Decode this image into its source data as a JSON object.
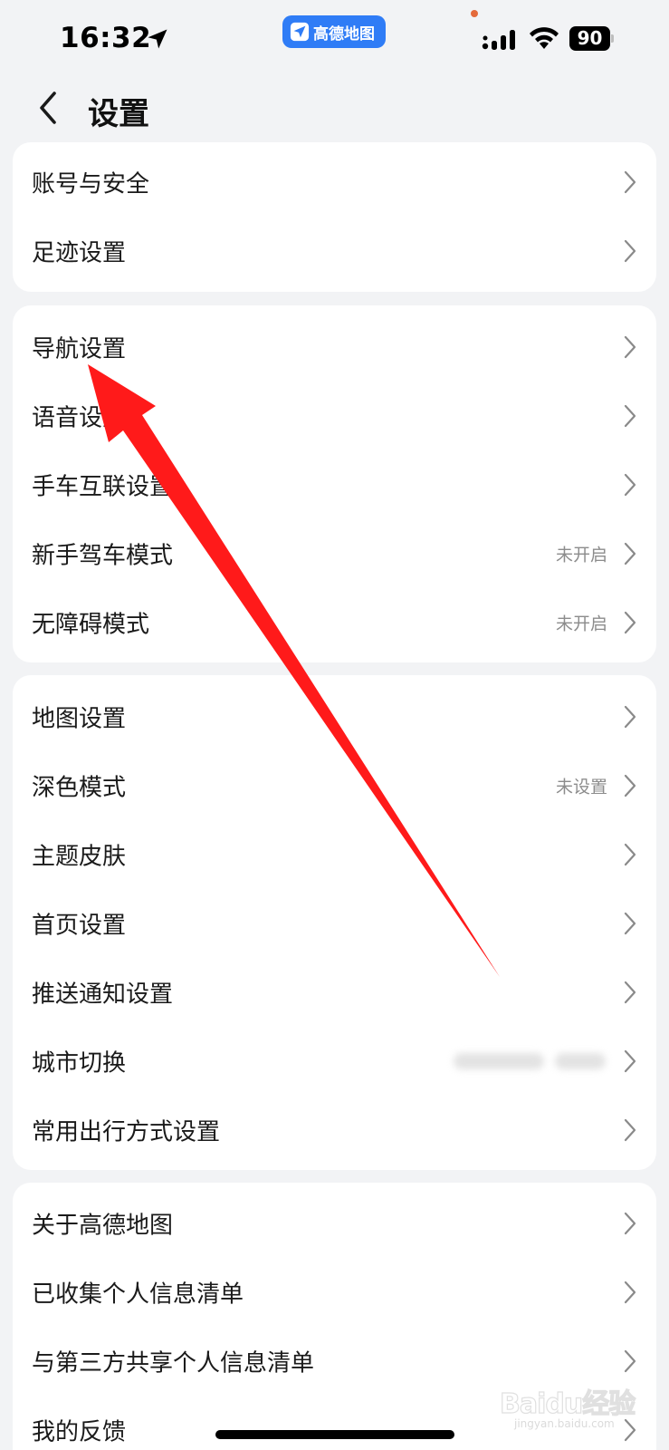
{
  "status_bar": {
    "time": "16:32",
    "app_pill_label": "高德地图",
    "battery": "90",
    "icons": [
      "location-arrow-icon",
      "signal-icon",
      "wifi-icon",
      "battery-icon"
    ]
  },
  "header": {
    "title": "设置"
  },
  "groups": [
    {
      "items": [
        {
          "label": "账号与安全",
          "value": ""
        },
        {
          "label": "足迹设置",
          "value": ""
        }
      ]
    },
    {
      "items": [
        {
          "label": "导航设置",
          "value": ""
        },
        {
          "label": "语音设置",
          "value": ""
        },
        {
          "label": "手车互联设置",
          "value": ""
        },
        {
          "label": "新手驾车模式",
          "value": "未开启"
        },
        {
          "label": "无障碍模式",
          "value": "未开启"
        }
      ]
    },
    {
      "items": [
        {
          "label": "地图设置",
          "value": ""
        },
        {
          "label": "深色模式",
          "value": "未设置"
        },
        {
          "label": "主题皮肤",
          "value": ""
        },
        {
          "label": "首页设置",
          "value": ""
        },
        {
          "label": "推送通知设置",
          "value": ""
        },
        {
          "label": "城市切换",
          "value": ""
        },
        {
          "label": "常用出行方式设置",
          "value": ""
        }
      ]
    },
    {
      "items": [
        {
          "label": "关于高德地图",
          "value": ""
        },
        {
          "label": "已收集个人信息清单",
          "value": ""
        },
        {
          "label": "与第三方共享个人信息清单",
          "value": ""
        },
        {
          "label": "我的反馈",
          "value": ""
        }
      ]
    }
  ],
  "annotation": {
    "color": "#ff1a1a"
  },
  "watermark": {
    "text": "Baidu经验",
    "sub": "jingyan.baidu.com"
  }
}
